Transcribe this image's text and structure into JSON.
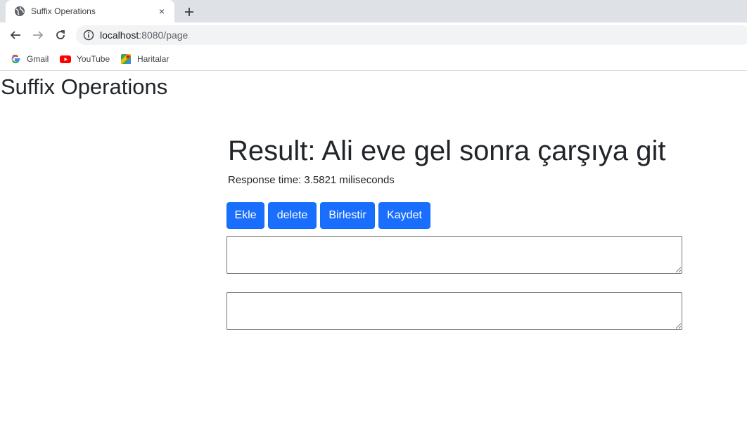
{
  "browser": {
    "tab": {
      "title": "Suffix Operations",
      "close_symbol": "×"
    },
    "new_tab_symbol": "+",
    "address": {
      "host": "localhost",
      "port_path": ":8080/page"
    },
    "bookmarks": [
      {
        "label": "Gmail",
        "icon": "google-icon"
      },
      {
        "label": "YouTube",
        "icon": "youtube-icon"
      },
      {
        "label": "Haritalar",
        "icon": "maps-icon"
      }
    ]
  },
  "page": {
    "title": "Suffix Operations",
    "result": "Result: Ali eve gel sonra çarşıya git",
    "response_time": "Response time: 3.5821 miliseconds",
    "buttons": {
      "add": "Ekle",
      "delete": "delete",
      "merge": "Birlestir",
      "save": "Kaydet"
    },
    "textarea1": {
      "value": ""
    },
    "textarea2": {
      "value": ""
    }
  },
  "colors": {
    "button_bg": "#1a6efd",
    "text": "#212529",
    "tabstrip": "#dee1e6"
  }
}
